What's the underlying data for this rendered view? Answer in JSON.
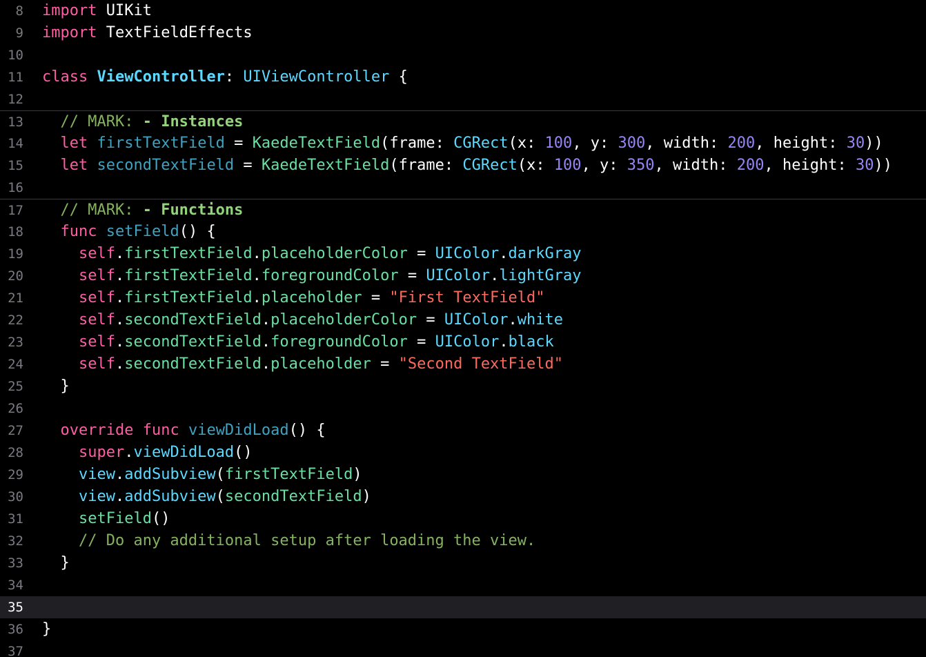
{
  "editor": {
    "language": "swift",
    "current_line": 35,
    "lines": [
      {
        "n": "8",
        "tokens": [
          {
            "t": "import",
            "c": "kw"
          },
          {
            "t": " UIKit",
            "c": "plain"
          }
        ]
      },
      {
        "n": "9",
        "tokens": [
          {
            "t": "import",
            "c": "kw"
          },
          {
            "t": " TextFieldEffects",
            "c": "plain"
          }
        ]
      },
      {
        "n": "10",
        "tokens": []
      },
      {
        "n": "11",
        "tokens": [
          {
            "t": "class",
            "c": "kw"
          },
          {
            "t": " ",
            "c": "plain"
          },
          {
            "t": "ViewController",
            "c": "typedecl"
          },
          {
            "t": ": ",
            "c": "plain"
          },
          {
            "t": "UIViewController",
            "c": "type"
          },
          {
            "t": " {",
            "c": "plain"
          }
        ]
      },
      {
        "n": "12",
        "tokens": []
      },
      {
        "n": "13",
        "sep": true,
        "tokens": [
          {
            "t": "  // MARK: ",
            "c": "greencomment"
          },
          {
            "t": "- Instances",
            "c": "mark"
          }
        ]
      },
      {
        "n": "14",
        "tokens": [
          {
            "t": "  ",
            "c": "plain"
          },
          {
            "t": "let",
            "c": "kw"
          },
          {
            "t": " ",
            "c": "plain"
          },
          {
            "t": "firstTextField",
            "c": "decl"
          },
          {
            "t": " = ",
            "c": "plain"
          },
          {
            "t": "KaedeTextField",
            "c": "prop"
          },
          {
            "t": "(frame: ",
            "c": "plain"
          },
          {
            "t": "CGRect",
            "c": "type"
          },
          {
            "t": "(x: ",
            "c": "plain"
          },
          {
            "t": "100",
            "c": "numv"
          },
          {
            "t": ", y: ",
            "c": "plain"
          },
          {
            "t": "300",
            "c": "numv"
          },
          {
            "t": ", width: ",
            "c": "plain"
          },
          {
            "t": "200",
            "c": "numv"
          },
          {
            "t": ", height: ",
            "c": "plain"
          },
          {
            "t": "30",
            "c": "numv"
          },
          {
            "t": "))",
            "c": "plain"
          }
        ]
      },
      {
        "n": "15",
        "tokens": [
          {
            "t": "  ",
            "c": "plain"
          },
          {
            "t": "let",
            "c": "kw"
          },
          {
            "t": " ",
            "c": "plain"
          },
          {
            "t": "secondTextField",
            "c": "decl"
          },
          {
            "t": " = ",
            "c": "plain"
          },
          {
            "t": "KaedeTextField",
            "c": "prop"
          },
          {
            "t": "(frame: ",
            "c": "plain"
          },
          {
            "t": "CGRect",
            "c": "type"
          },
          {
            "t": "(x: ",
            "c": "plain"
          },
          {
            "t": "100",
            "c": "numv"
          },
          {
            "t": ", y: ",
            "c": "plain"
          },
          {
            "t": "350",
            "c": "numv"
          },
          {
            "t": ", width: ",
            "c": "plain"
          },
          {
            "t": "200",
            "c": "numv"
          },
          {
            "t": ", height: ",
            "c": "plain"
          },
          {
            "t": "30",
            "c": "numv"
          },
          {
            "t": "))",
            "c": "plain"
          }
        ]
      },
      {
        "n": "16",
        "tokens": []
      },
      {
        "n": "17",
        "sep": true,
        "tokens": [
          {
            "t": "  // MARK: ",
            "c": "greencomment"
          },
          {
            "t": "- Functions",
            "c": "mark"
          }
        ]
      },
      {
        "n": "18",
        "tokens": [
          {
            "t": "  ",
            "c": "plain"
          },
          {
            "t": "func",
            "c": "kw"
          },
          {
            "t": " ",
            "c": "plain"
          },
          {
            "t": "setField",
            "c": "decl"
          },
          {
            "t": "() {",
            "c": "plain"
          }
        ]
      },
      {
        "n": "19",
        "tokens": [
          {
            "t": "    ",
            "c": "plain"
          },
          {
            "t": "self",
            "c": "self"
          },
          {
            "t": ".",
            "c": "plain"
          },
          {
            "t": "firstTextField",
            "c": "prop"
          },
          {
            "t": ".",
            "c": "plain"
          },
          {
            "t": "placeholderColor",
            "c": "prop"
          },
          {
            "t": " = ",
            "c": "plain"
          },
          {
            "t": "UIColor",
            "c": "type"
          },
          {
            "t": ".",
            "c": "plain"
          },
          {
            "t": "darkGray",
            "c": "type"
          }
        ]
      },
      {
        "n": "20",
        "tokens": [
          {
            "t": "    ",
            "c": "plain"
          },
          {
            "t": "self",
            "c": "self"
          },
          {
            "t": ".",
            "c": "plain"
          },
          {
            "t": "firstTextField",
            "c": "prop"
          },
          {
            "t": ".",
            "c": "plain"
          },
          {
            "t": "foregroundColor",
            "c": "prop"
          },
          {
            "t": " = ",
            "c": "plain"
          },
          {
            "t": "UIColor",
            "c": "type"
          },
          {
            "t": ".",
            "c": "plain"
          },
          {
            "t": "lightGray",
            "c": "type"
          }
        ]
      },
      {
        "n": "21",
        "tokens": [
          {
            "t": "    ",
            "c": "plain"
          },
          {
            "t": "self",
            "c": "self"
          },
          {
            "t": ".",
            "c": "plain"
          },
          {
            "t": "firstTextField",
            "c": "prop"
          },
          {
            "t": ".",
            "c": "plain"
          },
          {
            "t": "placeholder",
            "c": "prop"
          },
          {
            "t": " = ",
            "c": "plain"
          },
          {
            "t": "\"First TextField\"",
            "c": "str"
          }
        ]
      },
      {
        "n": "22",
        "tokens": [
          {
            "t": "    ",
            "c": "plain"
          },
          {
            "t": "self",
            "c": "self"
          },
          {
            "t": ".",
            "c": "plain"
          },
          {
            "t": "secondTextField",
            "c": "prop"
          },
          {
            "t": ".",
            "c": "plain"
          },
          {
            "t": "placeholderColor",
            "c": "prop"
          },
          {
            "t": " = ",
            "c": "plain"
          },
          {
            "t": "UIColor",
            "c": "type"
          },
          {
            "t": ".",
            "c": "plain"
          },
          {
            "t": "white",
            "c": "type"
          }
        ]
      },
      {
        "n": "23",
        "tokens": [
          {
            "t": "    ",
            "c": "plain"
          },
          {
            "t": "self",
            "c": "self"
          },
          {
            "t": ".",
            "c": "plain"
          },
          {
            "t": "secondTextField",
            "c": "prop"
          },
          {
            "t": ".",
            "c": "plain"
          },
          {
            "t": "foregroundColor",
            "c": "prop"
          },
          {
            "t": " = ",
            "c": "plain"
          },
          {
            "t": "UIColor",
            "c": "type"
          },
          {
            "t": ".",
            "c": "plain"
          },
          {
            "t": "black",
            "c": "type"
          }
        ]
      },
      {
        "n": "24",
        "tokens": [
          {
            "t": "    ",
            "c": "plain"
          },
          {
            "t": "self",
            "c": "self"
          },
          {
            "t": ".",
            "c": "plain"
          },
          {
            "t": "secondTextField",
            "c": "prop"
          },
          {
            "t": ".",
            "c": "plain"
          },
          {
            "t": "placeholder",
            "c": "prop"
          },
          {
            "t": " = ",
            "c": "plain"
          },
          {
            "t": "\"Second TextField\"",
            "c": "str"
          }
        ]
      },
      {
        "n": "25",
        "tokens": [
          {
            "t": "  }",
            "c": "plain"
          }
        ]
      },
      {
        "n": "26",
        "tokens": []
      },
      {
        "n": "27",
        "tokens": [
          {
            "t": "  ",
            "c": "plain"
          },
          {
            "t": "override",
            "c": "kw"
          },
          {
            "t": " ",
            "c": "plain"
          },
          {
            "t": "func",
            "c": "kw"
          },
          {
            "t": " ",
            "c": "plain"
          },
          {
            "t": "viewDidLoad",
            "c": "decl"
          },
          {
            "t": "() {",
            "c": "plain"
          }
        ]
      },
      {
        "n": "28",
        "tokens": [
          {
            "t": "    ",
            "c": "plain"
          },
          {
            "t": "super",
            "c": "self"
          },
          {
            "t": ".",
            "c": "plain"
          },
          {
            "t": "viewDidLoad",
            "c": "type"
          },
          {
            "t": "()",
            "c": "plain"
          }
        ]
      },
      {
        "n": "29",
        "tokens": [
          {
            "t": "    ",
            "c": "plain"
          },
          {
            "t": "view",
            "c": "type"
          },
          {
            "t": ".",
            "c": "plain"
          },
          {
            "t": "addSubview",
            "c": "type"
          },
          {
            "t": "(",
            "c": "plain"
          },
          {
            "t": "firstTextField",
            "c": "prop"
          },
          {
            "t": ")",
            "c": "plain"
          }
        ]
      },
      {
        "n": "30",
        "tokens": [
          {
            "t": "    ",
            "c": "plain"
          },
          {
            "t": "view",
            "c": "type"
          },
          {
            "t": ".",
            "c": "plain"
          },
          {
            "t": "addSubview",
            "c": "type"
          },
          {
            "t": "(",
            "c": "plain"
          },
          {
            "t": "secondTextField",
            "c": "prop"
          },
          {
            "t": ")",
            "c": "plain"
          }
        ]
      },
      {
        "n": "31",
        "tokens": [
          {
            "t": "    ",
            "c": "plain"
          },
          {
            "t": "setField",
            "c": "prop"
          },
          {
            "t": "()",
            "c": "plain"
          }
        ]
      },
      {
        "n": "32",
        "tokens": [
          {
            "t": "    // Do any additional setup after loading the view.",
            "c": "greencomment"
          }
        ]
      },
      {
        "n": "33",
        "tokens": [
          {
            "t": "  }",
            "c": "plain"
          }
        ]
      },
      {
        "n": "34",
        "tokens": []
      },
      {
        "n": "35",
        "current": true,
        "tokens": []
      },
      {
        "n": "36",
        "tokens": [
          {
            "t": "}",
            "c": "plain"
          }
        ]
      },
      {
        "n": "37",
        "tokens": []
      }
    ]
  }
}
